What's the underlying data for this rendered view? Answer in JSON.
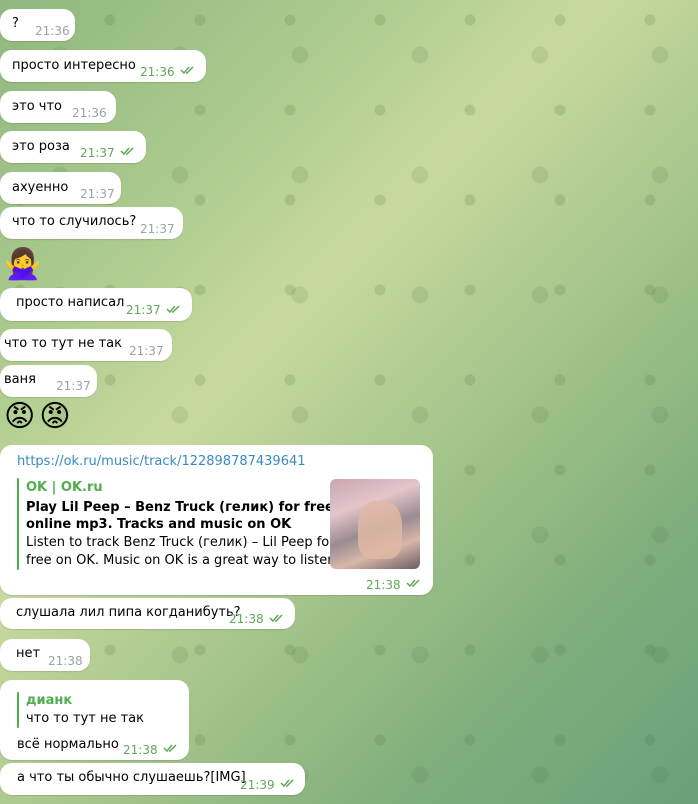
{
  "messages": [
    {
      "text": "?",
      "time": "21:36"
    },
    {
      "text": "просто интересно",
      "time": "21:36"
    },
    {
      "text": "это что",
      "time": "21:36"
    },
    {
      "text": "это роза",
      "time": "21:37"
    },
    {
      "text": "ахуенно",
      "time": "21:37"
    },
    {
      "text": "что то случилось?",
      "time": "21:37"
    },
    {
      "text": "просто написал",
      "time": "21:37"
    },
    {
      "text": "что то тут не так",
      "time": "21:37"
    },
    {
      "text": "ваня",
      "time": "21:37"
    },
    {
      "text": "слушала лил пипа когданибуть?",
      "time": "21:38"
    },
    {
      "text": "нет",
      "time": "21:38"
    },
    {
      "text": "а что ты обычно слушаешь?[IMG]",
      "time": "21:39"
    }
  ],
  "emoji_messages": [
    {
      "emoji": "🙅‍♀️",
      "icon": "woman-gesturing-no-emoji"
    },
    {
      "emoji": "😡😡",
      "icon": "angry-face-emoji"
    }
  ],
  "link_message": {
    "url": "https://ok.ru/music/track/122898787439641",
    "site": "OK | OK.ru",
    "title_line1": "Play Lil Peep – Benz Truck (гелик) for free",
    "title_line2": "online mp3. Tracks and music on OK",
    "desc_line1": "Listen to track Benz Truck (гелик) – Lil Peep for",
    "desc_line2": "free on OK. Music on OK is a great way to listen t...",
    "time": "21:38"
  },
  "reply_message": {
    "reply_author": "дианк",
    "reply_text": "что то тут не так",
    "text": "всё нормально",
    "time": "21:38"
  },
  "colors": {
    "outgoing_meta": "#5fa85a",
    "incoming_meta": "#9aa3a9",
    "link": "#3a8ac4",
    "accent": "#4fae4e"
  }
}
